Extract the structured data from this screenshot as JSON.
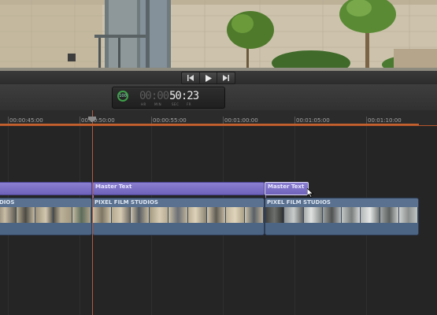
{
  "transport": {
    "buttons": [
      {
        "name": "previous-edit",
        "icon": "skip-back-icon"
      },
      {
        "name": "play",
        "icon": "play-icon"
      },
      {
        "name": "next-edit",
        "icon": "skip-forward-icon"
      }
    ]
  },
  "dashboard": {
    "percent": "100",
    "timecode_dim": "00:00:",
    "timecode_main": "50:23",
    "units": [
      "HR",
      "MIN",
      "SEC",
      "FR"
    ]
  },
  "ruler": {
    "labels": [
      "00:00:45:00",
      "00:00:50:00",
      "00:00:55:00",
      "00:01:00:00",
      "00:01:05:00",
      "00:01:10:00"
    ]
  },
  "titles": [
    {
      "label": ""
    },
    {
      "label": "Master Text"
    },
    {
      "label": "Master Text",
      "selected": true
    }
  ],
  "clips": [
    {
      "label": "DIOS"
    },
    {
      "label": "PIXEL FILM STUDIOS"
    },
    {
      "label": "PIXEL FILM STUDIOS"
    }
  ],
  "colors": {
    "title_clip": "#7b70c6",
    "video_clip": "#4a5f7c",
    "playhead": "#b05a45",
    "range_bar": "#c2602e",
    "percent_ring": "#3da14a"
  }
}
